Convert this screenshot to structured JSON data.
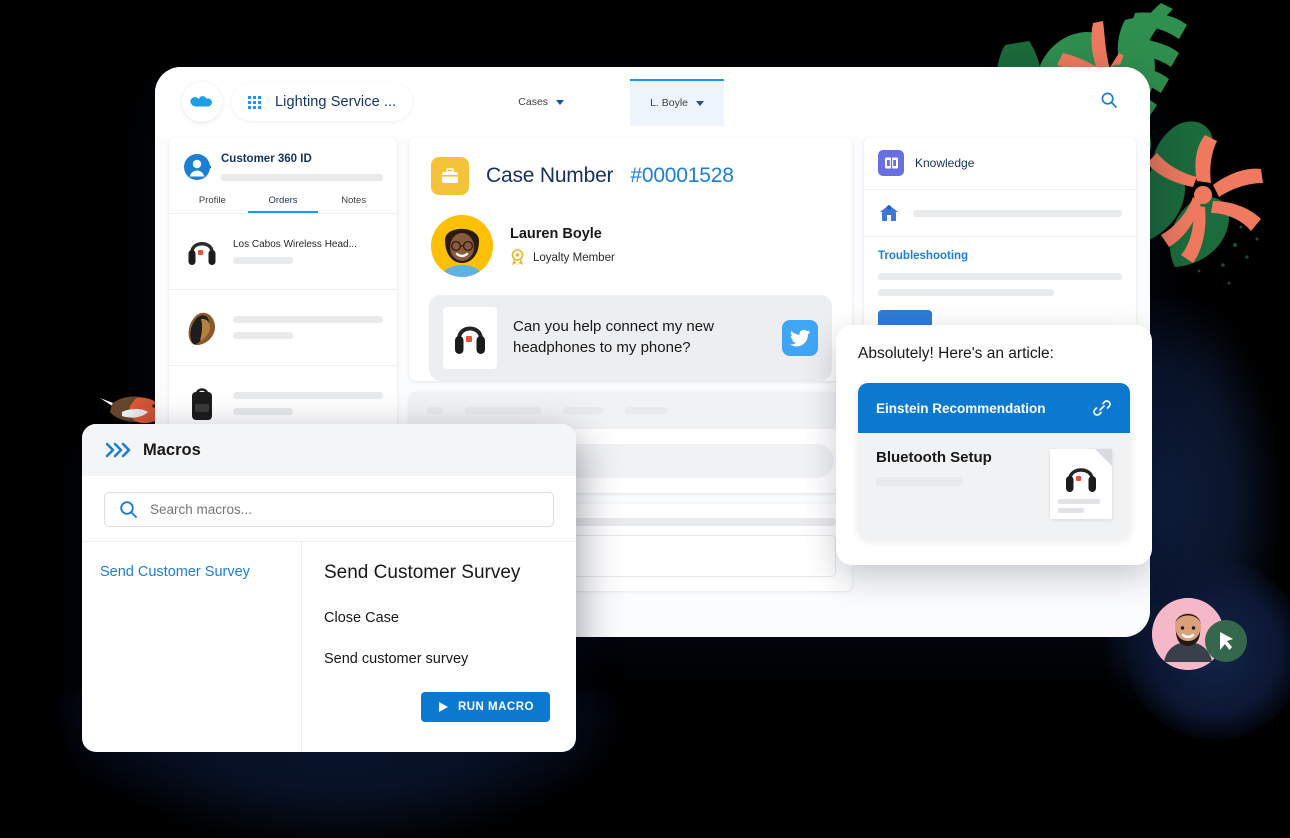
{
  "colors": {
    "background": "#000000",
    "brand_blue": "#1b96ff",
    "link_blue": "#1b7fd4",
    "button_blue": "#0b79d0",
    "case_icon_yellow": "#f5c33b",
    "avatar_yellow": "#fcc003",
    "knowledge_purple": "#6a6fe0",
    "twitter_blue": "#41a5f5",
    "navy_glow": "#0e1c38",
    "leaf_green_dark": "#1c6b3c",
    "leaf_green": "#2f8f4e",
    "coral": "#f07a5f",
    "agent_pink": "#f5b8c8",
    "agent_badge_green": "#35674d"
  },
  "window": {
    "topbar": {
      "logo_icon": "salesforce-cloud-icon",
      "app_launcher_icon": "app-launcher-grid-icon",
      "app_name": "Lighting Service ...",
      "tabs": [
        {
          "label": "Cases",
          "active": false,
          "icon": "chevron-down-icon"
        },
        {
          "label": "L. Boyle",
          "active": true,
          "icon": "chevron-down-icon"
        }
      ],
      "search_icon": "search-icon"
    },
    "left_panel": {
      "icon": "customer-avatar-icon",
      "title": "Customer 360 ID",
      "tabs": [
        {
          "label": "Profile",
          "selected": false
        },
        {
          "label": "Orders",
          "selected": true
        },
        {
          "label": "Notes",
          "selected": false
        }
      ],
      "orders": [
        {
          "name": "Los Cabos Wireless Head...",
          "thumb": "headphones-thumb"
        },
        {
          "name": "",
          "thumb": "glove-thumb"
        },
        {
          "name": "",
          "thumb": "backpack-thumb"
        }
      ]
    },
    "case_panel": {
      "icon": "briefcase-icon",
      "label": "Case Number",
      "number": "#00001528",
      "customer": {
        "avatar": "lauren-boyle-avatar",
        "name": "Lauren Boyle",
        "badge_icon": "loyalty-ribbon-icon",
        "badge_label": "Loyalty Member"
      },
      "message": {
        "thumb": "headphones-thumb",
        "text": "Can you help connect my new headphones to my phone?",
        "channel_icon": "twitter-icon"
      }
    },
    "right_panel": {
      "icon": "book-icon",
      "title": "Knowledge",
      "row_icon": "article-house-icon",
      "section_link": "Troubleshooting",
      "button_icon": "primary-action-button"
    }
  },
  "einstein_popup": {
    "lead": "Absolutely! Here's an article:",
    "card": {
      "header": "Einstein Recommendation",
      "header_icon": "link-icon",
      "title": "Bluetooth Setup",
      "doc_icon": "document-thumbnail"
    }
  },
  "macros": {
    "header_icon": "macros-chevrons-icon",
    "header_title": "Macros",
    "search": {
      "icon": "search-icon",
      "placeholder": "Search macros...",
      "value": ""
    },
    "list": [
      {
        "label": "Send Customer Survey",
        "selected": true
      }
    ],
    "detail": {
      "title": "Send Customer Survey",
      "steps": [
        "Close Case",
        "Send customer survey"
      ],
      "run_button": {
        "label": "RUN MACRO",
        "icon": "play-icon"
      }
    }
  },
  "decor": {
    "bird": "bird-illustration",
    "foliage": "tropical-leaves-illustration",
    "agent_avatar": "support-agent-avatar",
    "agent_badge_icon": "cursor-badge-icon"
  }
}
